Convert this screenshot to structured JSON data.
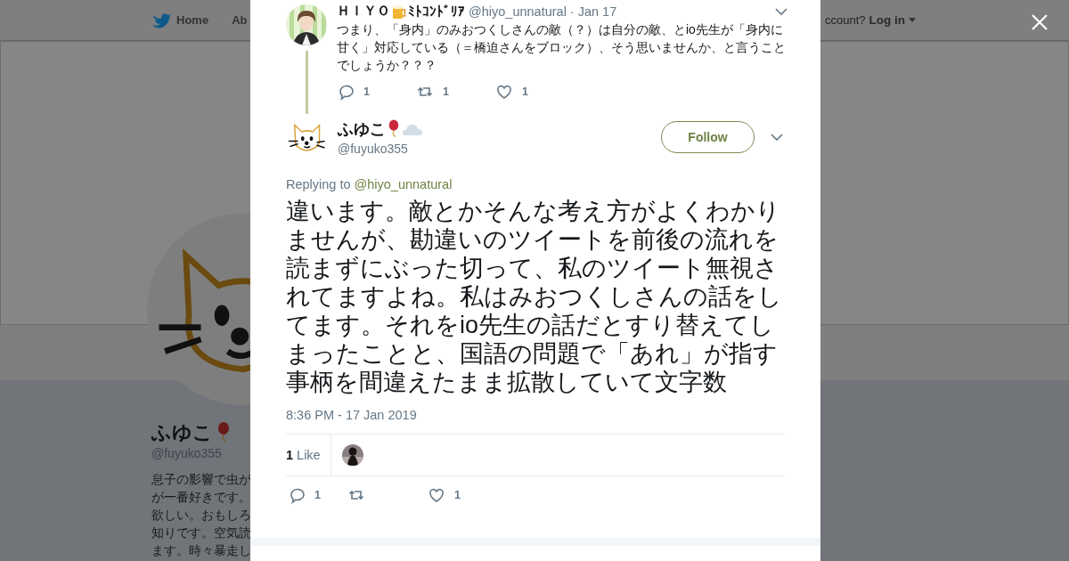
{
  "background_page": {
    "nav": [
      {
        "label": "Home",
        "kind": "home"
      },
      {
        "label": "Ab",
        "kind": "text"
      }
    ],
    "login_prompt": "ccount?",
    "login_link": "Log in",
    "profile": {
      "name": "ふゆこ",
      "handle": "@fuyuko355",
      "bio_lines": [
        "息子の影響で虫が",
        "が一番好きです。",
        "欲しい。おもしろ",
        "知りです。空気読",
        "ます。時々暴走し"
      ]
    }
  },
  "parent_tweet": {
    "name_prefix": "ＨＩＹＯ",
    "name_suffix": "ﾐﾄｺﾝﾄﾞﾘｱ",
    "handle": "@hiyo_unnatural",
    "date": "· Jan 17",
    "text": "つまり、「身内」のみおつくしさんの敵（？）は自分の敵、とio先生が「身内に甘く」対応している（＝橋迫さんをブロック）、そう思いませんか、と言うことでしょうか？？？",
    "actions": [
      {
        "kind": "reply",
        "count": "1"
      },
      {
        "kind": "retweet",
        "count": "1"
      },
      {
        "kind": "like",
        "count": "1"
      }
    ]
  },
  "tweet": {
    "name": "ふゆこ",
    "handle": "@fuyuko355",
    "follow_label": "Follow",
    "replying_to_label": "Replying to",
    "replying_to": "@hiyo_unnatural",
    "text": "違います。敵とかそんな考え方がよくわかりませんが、勘違いのツイートを前後の流れを読まずにぶった切って、私のツイート無視されてますよね。私はみおつくしさんの話をしてます。それをio先生の話だとすり替えてしまったことと、国語の問題で「あれ」が指す事柄を間違えたまま拡散していて文字数",
    "timestamp": "8:36 PM - 17 Jan 2019",
    "likes_count": "1",
    "likes_label": "Like",
    "actions": [
      {
        "kind": "reply",
        "count": "1"
      },
      {
        "kind": "retweet"
      },
      {
        "kind": "like",
        "count": "1"
      }
    ]
  }
}
